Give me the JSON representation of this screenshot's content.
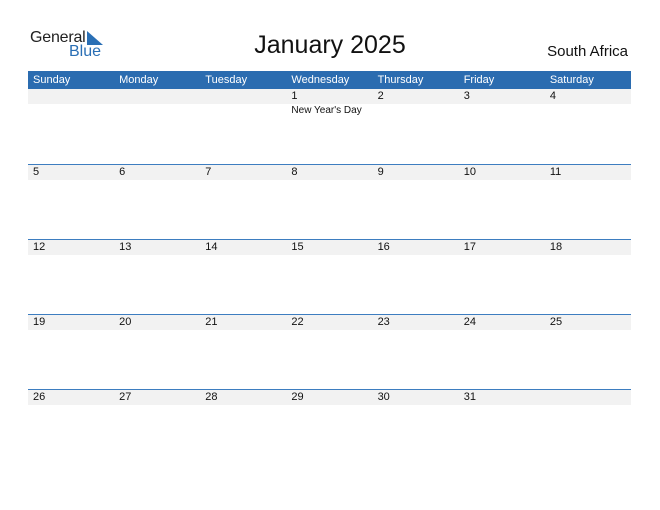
{
  "brand": {
    "line1": "General",
    "line2": "Blue",
    "accent": "#2a6fb5"
  },
  "title": "January 2025",
  "country": "South Africa",
  "colors": {
    "header_bg": "#2b6cb0",
    "day_strip_bg": "#f2f2f2",
    "row_line": "#3d7dc0"
  },
  "weekdays": [
    "Sunday",
    "Monday",
    "Tuesday",
    "Wednesday",
    "Thursday",
    "Friday",
    "Saturday"
  ],
  "weeks": [
    {
      "days": [
        "",
        "",
        "",
        "1",
        "2",
        "3",
        "4"
      ],
      "events": [
        "",
        "",
        "",
        "New Year's Day",
        "",
        "",
        ""
      ]
    },
    {
      "days": [
        "5",
        "6",
        "7",
        "8",
        "9",
        "10",
        "11"
      ],
      "events": [
        "",
        "",
        "",
        "",
        "",
        "",
        ""
      ]
    },
    {
      "days": [
        "12",
        "13",
        "14",
        "15",
        "16",
        "17",
        "18"
      ],
      "events": [
        "",
        "",
        "",
        "",
        "",
        "",
        ""
      ]
    },
    {
      "days": [
        "19",
        "20",
        "21",
        "22",
        "23",
        "24",
        "25"
      ],
      "events": [
        "",
        "",
        "",
        "",
        "",
        "",
        ""
      ]
    },
    {
      "days": [
        "26",
        "27",
        "28",
        "29",
        "30",
        "31",
        ""
      ],
      "events": [
        "",
        "",
        "",
        "",
        "",
        "",
        ""
      ]
    }
  ]
}
